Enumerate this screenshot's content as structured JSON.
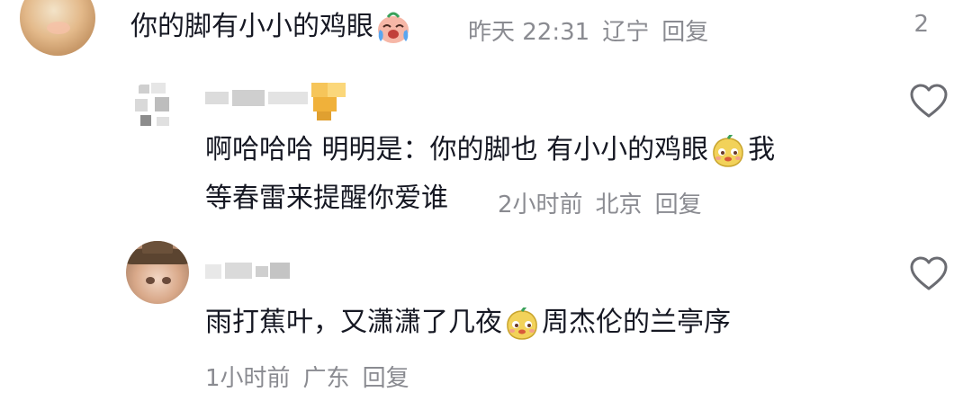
{
  "comments": [
    {
      "text_before": "你的脚有小小的鸡眼",
      "emoji": "crying-laughing-emoji",
      "time": "昨天 22:31",
      "location": "辽宁",
      "reply": "回复",
      "count": "2"
    },
    {
      "line1_before": "啊哈哈哈 明明是：你的脚也 有小小的鸡眼",
      "emoji": "pear-face-emoji",
      "line1_after": "我",
      "line2": "等春雷来提醒你爱谁",
      "time": "2小时前",
      "location": "北京",
      "reply": "回复"
    },
    {
      "text_before": "雨打蕉叶，又潇潇了几夜",
      "emoji": "pear-face-emoji",
      "text_after": "周杰伦的兰亭序",
      "time": "1小时前",
      "location": "广东",
      "reply": "回复"
    }
  ],
  "icons": {
    "like": "heart-outline-icon"
  },
  "colors": {
    "text": "#161823",
    "meta": "#8a8b91",
    "icon": "#6b6c72"
  }
}
